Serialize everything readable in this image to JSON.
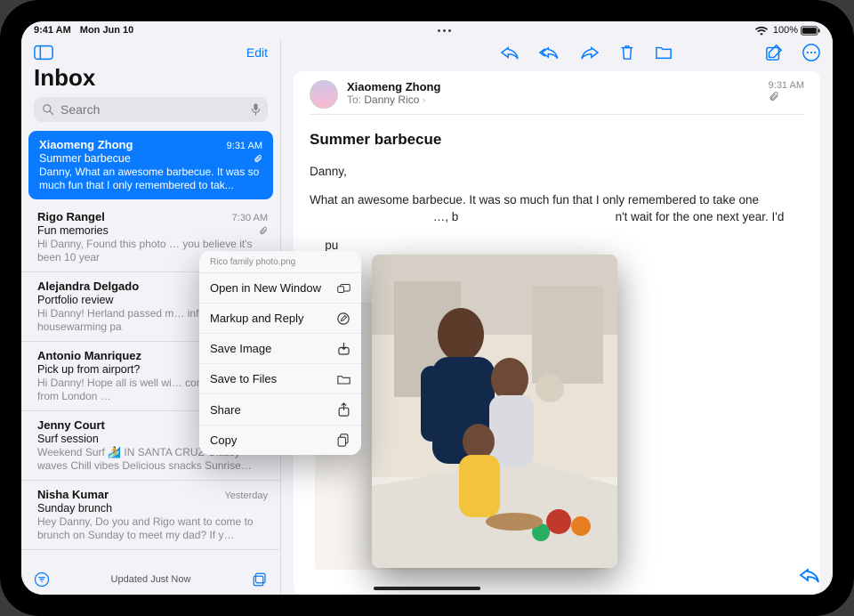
{
  "status": {
    "time": "9:41 AM",
    "date": "Mon Jun 10",
    "wifi": "100%",
    "battery": "100%"
  },
  "sidebar": {
    "edit_label": "Edit",
    "title": "Inbox",
    "search_placeholder": "Search",
    "updated": "Updated Just Now",
    "items": [
      {
        "from": "Xiaomeng Zhong",
        "time": "9:31 AM",
        "subject": "Summer barbecue",
        "preview": "Danny, What an awesome barbecue. It was so much fun that I only remembered to tak...",
        "has_attachment": true
      },
      {
        "from": "Rigo Rangel",
        "time": "7:30 AM",
        "subject": "Fun memories",
        "preview": "Hi Danny, Found this photo … you believe it's been 10 year",
        "has_attachment": true
      },
      {
        "from": "Alejandra Delgado",
        "time": "",
        "subject": "Portfolio review",
        "preview": "Hi Danny! Herland passed m… info at his housewarming pa",
        "has_attachment": false
      },
      {
        "from": "Antonio Manriquez",
        "time": "",
        "subject": "Pick up from airport?",
        "preview": "Hi Danny! Hope all is well wi… coming home from London …",
        "has_attachment": false
      },
      {
        "from": "Jenny Court",
        "time": "",
        "subject": "Surf session",
        "preview": "Weekend Surf 🏄 IN SANTA CRUZ Glassy waves Chill vibes Delicious snacks Sunrise…",
        "has_attachment": false
      },
      {
        "from": "Nisha Kumar",
        "time": "Yesterday",
        "subject": "Sunday brunch",
        "preview": "Hey Danny, Do you and Rigo want to come to brunch on Sunday to meet my dad? If y…",
        "has_attachment": false
      }
    ]
  },
  "message": {
    "from": "Xiaomeng Zhong",
    "to_label": "To:",
    "to_name": "Danny Rico",
    "time": "9:31 AM",
    "subject": "Summer barbecue",
    "greeting": "Danny,",
    "body1": "What an awesome barbecue. It was so much fun that I only remembered to take one ",
    "body1b": "…, b",
    "body1c": "n't wait for the one next year. I'd",
    "body2": " pu"
  },
  "context_menu": {
    "filename": "Rico family photo.png",
    "items": [
      "Open in New Window",
      "Markup and Reply",
      "Save Image",
      "Save to Files",
      "Share",
      "Copy"
    ]
  }
}
